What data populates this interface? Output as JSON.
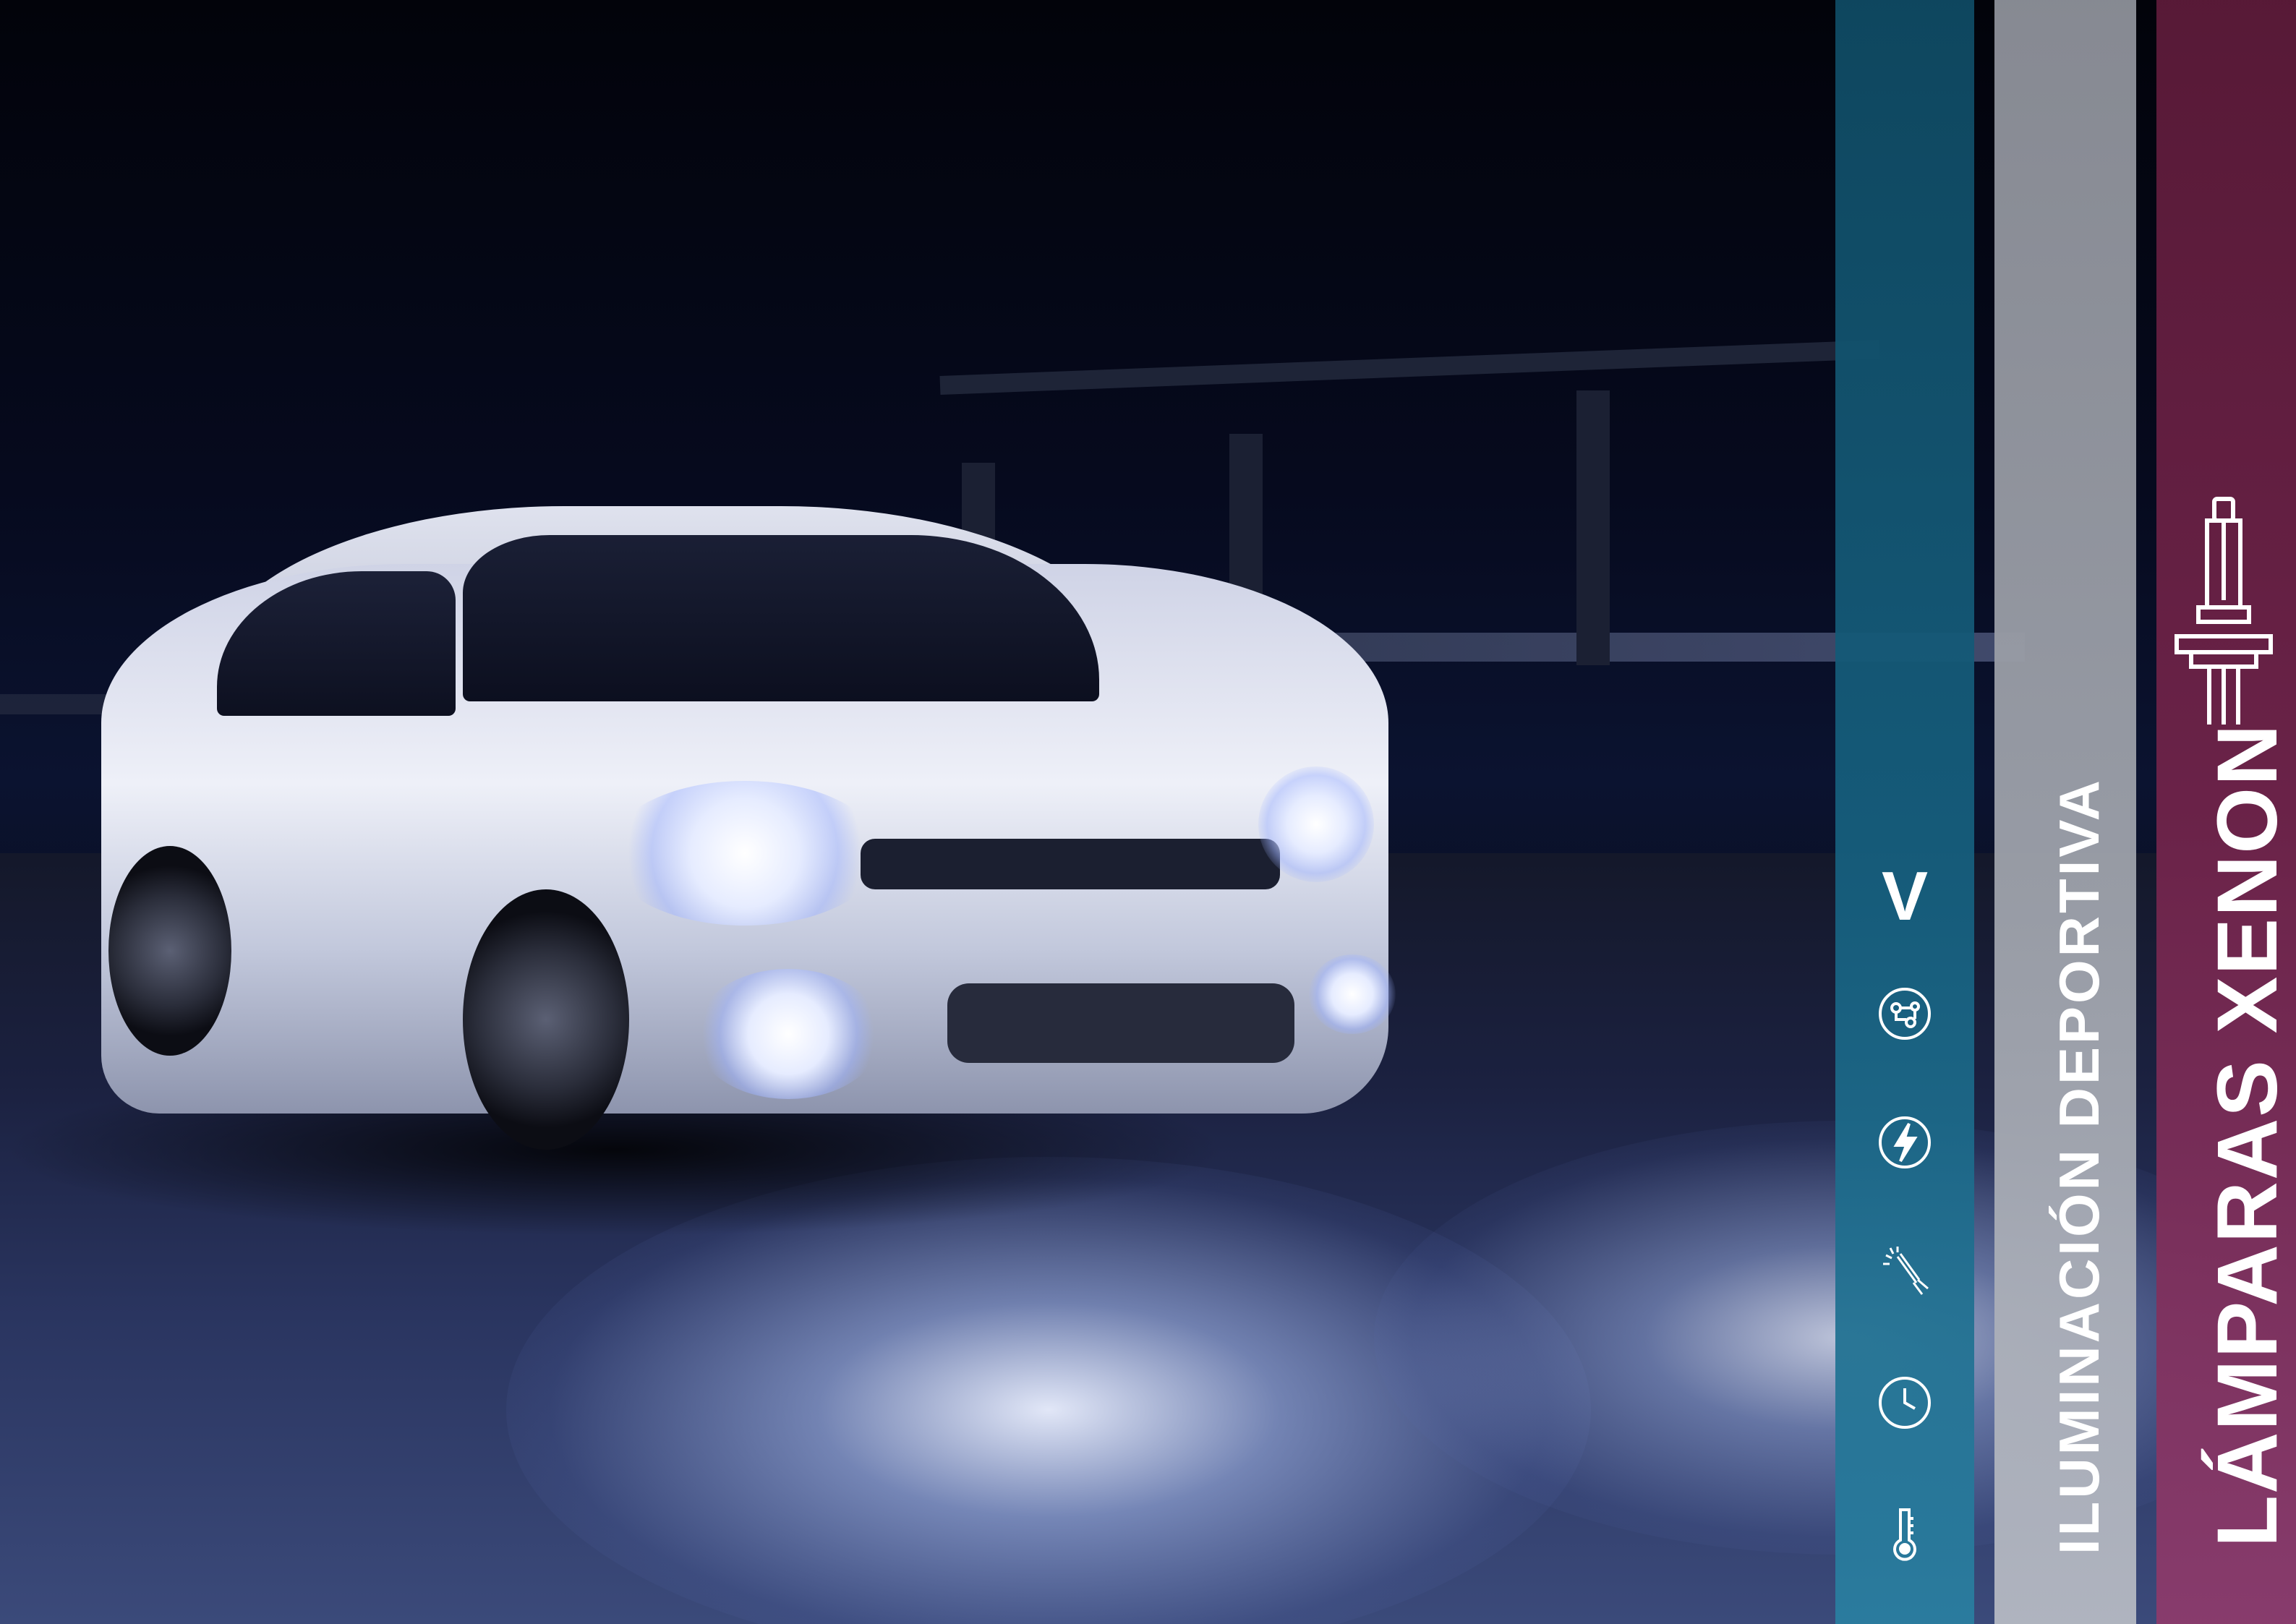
{
  "poster": {
    "subtitle": "ILUMINACIÓN DEPORTIVA",
    "title": "LÁMPARAS XENON"
  },
  "icons": [
    {
      "name": "v-logo-icon",
      "glyph": "V"
    },
    {
      "name": "circuit-icon"
    },
    {
      "name": "lightning-icon"
    },
    {
      "name": "bulb-spark-icon"
    },
    {
      "name": "clock-icon"
    },
    {
      "name": "thermometer-icon"
    }
  ],
  "colors": {
    "stripe_blue": "#165f7e",
    "stripe_grey": "#9da1aa",
    "stripe_purple": "#6d2349",
    "background": "#05060f"
  }
}
